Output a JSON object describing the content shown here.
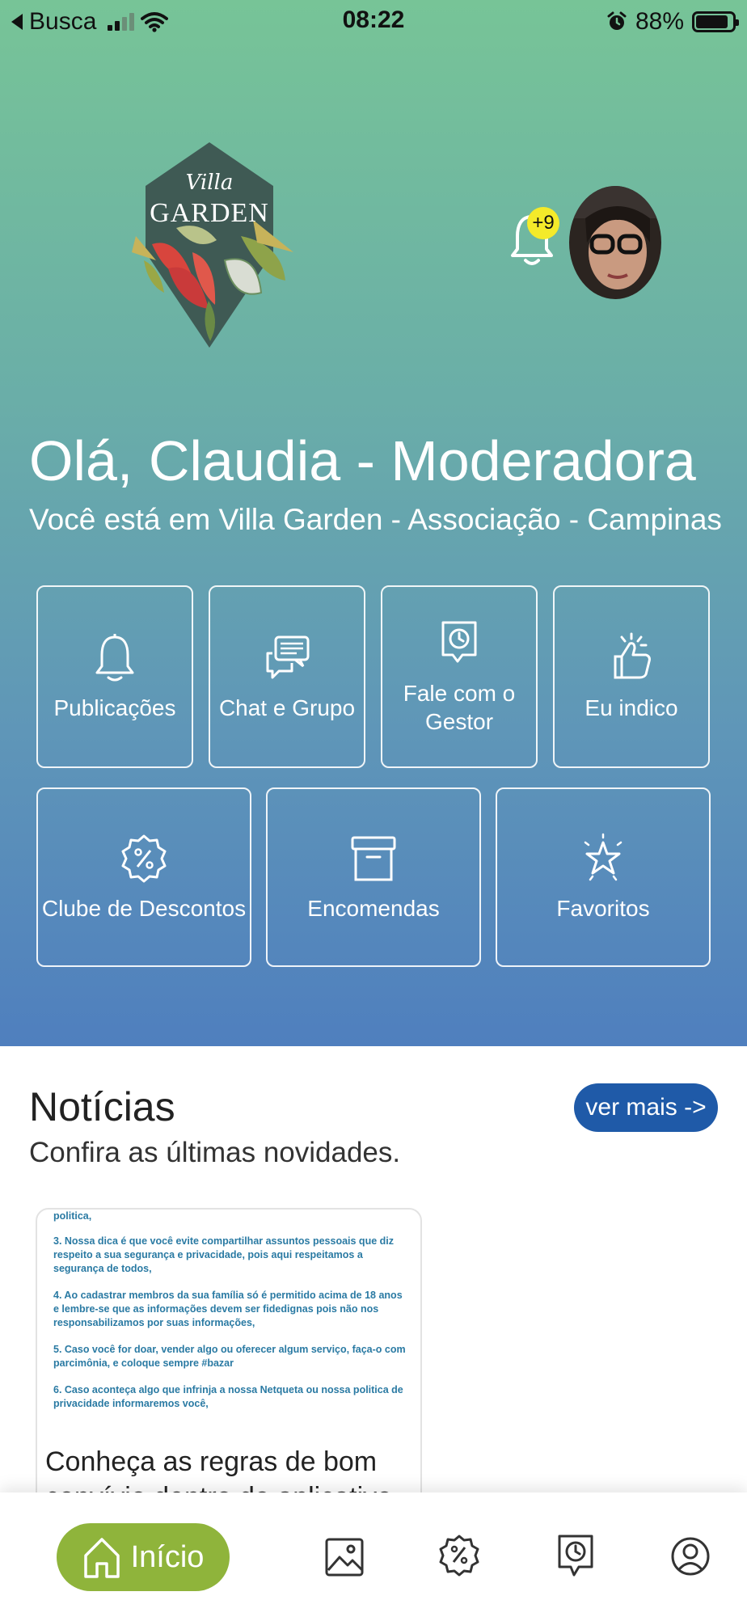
{
  "status_bar": {
    "back_app": "Busca",
    "time": "08:22",
    "battery_percent": "88%",
    "battery_level": 0.88
  },
  "brand": {
    "logo_top": "Villa",
    "logo_main": "GARDEN"
  },
  "notifications": {
    "badge": "+9"
  },
  "greeting": "Olá, Claudia - Moderadora",
  "location": "Você está em Villa Garden - Associação - Campinas",
  "tiles_row1": [
    {
      "label": "Publicações",
      "icon": "bell-icon"
    },
    {
      "label": "Chat e Grupo",
      "icon": "chat-bubbles-icon"
    },
    {
      "label": "Fale com o Gestor",
      "icon": "clock-message-icon"
    },
    {
      "label": "Eu indico",
      "icon": "thumbs-up-icon"
    }
  ],
  "tiles_row2": [
    {
      "label": "Clube de Descontos",
      "icon": "discount-badge-icon"
    },
    {
      "label": "Encomendas",
      "icon": "archive-box-icon"
    },
    {
      "label": "Favoritos",
      "icon": "star-icon"
    }
  ],
  "news": {
    "title": "Notícias",
    "subtitle": "Confira as últimas novidades.",
    "more_button": "ver mais ->",
    "card": {
      "image_lines": [
        "politica,",
        "3. Nossa dica é que você evite compartilhar assuntos pessoais que diz respeito a sua segurança e privacidade, pois aqui respeitamos a segurança de todos,",
        "4. Ao cadastrar membros da sua família só é permitido acima de 18 anos e lembre-se que as informações devem ser fidedignas pois não nos responsabilizamos por suas informações,",
        "5. Caso você for doar, vender algo ou oferecer algum serviço, faça-o com parcimônia, e coloque sempre #bazar",
        "6. Caso aconteça algo que infrinja a nossa Netqueta ou nossa politica de privacidade informaremos você,"
      ],
      "caption": "Conheça as regras de bom convívio dentro do aplicativo"
    }
  },
  "bottom_nav": {
    "home_label": "Início",
    "items": [
      "home-icon",
      "gallery-icon",
      "discount-icon",
      "message-clock-icon",
      "profile-icon"
    ]
  },
  "colors": {
    "gradient_top": "#77c497",
    "gradient_bottom": "#4f7fbe",
    "home_pill": "#8fb43b",
    "more_button": "#1f5aa8",
    "badge": "#f4ea2a"
  }
}
